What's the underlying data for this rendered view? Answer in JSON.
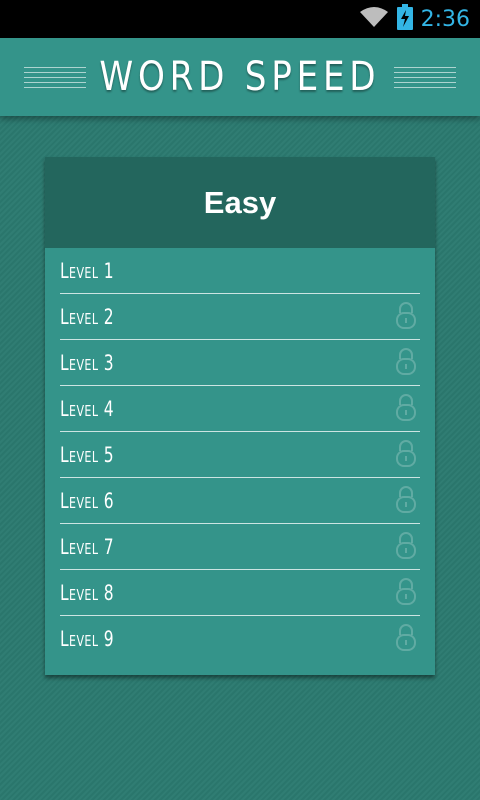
{
  "status_bar": {
    "time": "2:36",
    "icons": [
      "wifi-icon",
      "battery-charging-icon"
    ],
    "time_color": "#33b5e5"
  },
  "header": {
    "title": "WORD SPEED",
    "background": "#34948a"
  },
  "card": {
    "title": "Easy",
    "header_color": "#23665d",
    "levels": [
      {
        "label": "Level 1",
        "locked": false
      },
      {
        "label": "Level 2",
        "locked": true
      },
      {
        "label": "Level 3",
        "locked": true
      },
      {
        "label": "Level 4",
        "locked": true
      },
      {
        "label": "Level 5",
        "locked": true
      },
      {
        "label": "Level 6",
        "locked": true
      },
      {
        "label": "Level 7",
        "locked": true
      },
      {
        "label": "Level 8",
        "locked": true
      },
      {
        "label": "Level 9",
        "locked": true
      }
    ]
  }
}
